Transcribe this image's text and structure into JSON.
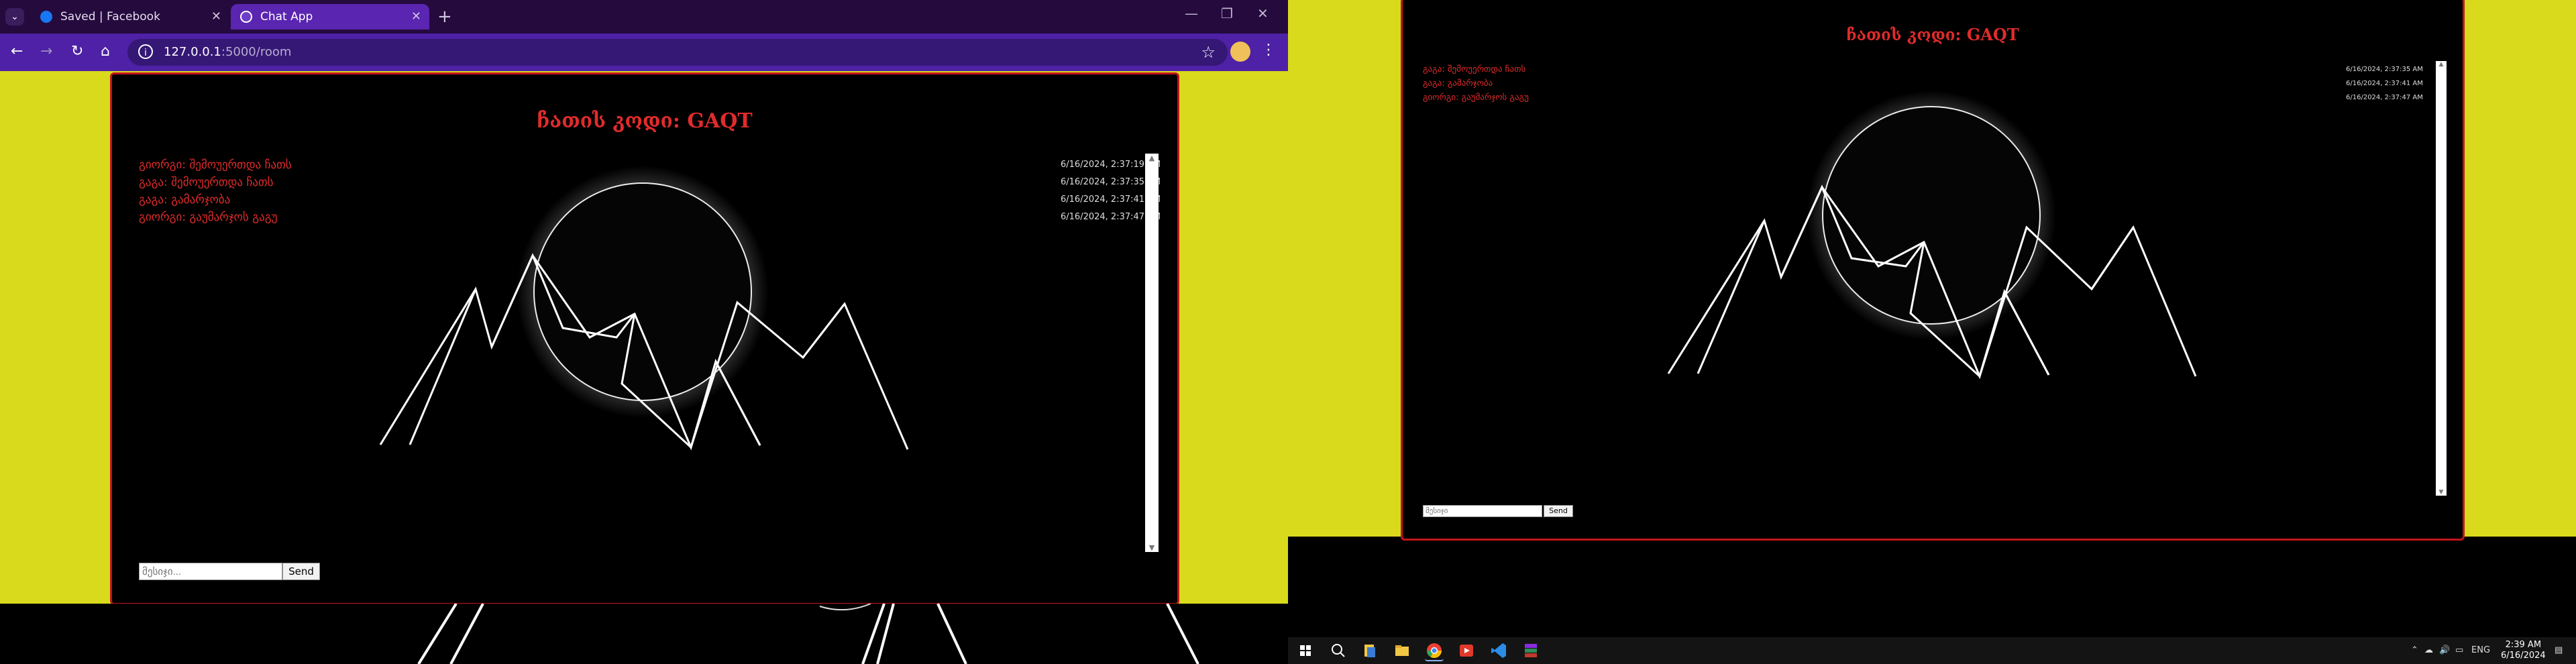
{
  "browser": {
    "tabs": [
      {
        "label": "Saved | Facebook",
        "active": false,
        "icon": "facebook-icon"
      },
      {
        "label": "Chat App",
        "active": true,
        "icon": "chat-app-icon"
      }
    ],
    "url_host": "127.0.0.1",
    "url_rest": ":5000/room"
  },
  "chat_left": {
    "title": "ჩათის კოდი: GAQT",
    "messages": [
      {
        "sender": "გიორგი",
        "text": "შემოუერთდა ჩათს",
        "time": "6/16/2024, 2:37:19 AM"
      },
      {
        "sender": "გაგა",
        "text": "შემოუერთდა ჩათს",
        "time": "6/16/2024, 2:37:35 AM"
      },
      {
        "sender": "გაგა",
        "text": "გამარჯობა",
        "time": "6/16/2024, 2:37:41 AM"
      },
      {
        "sender": "გიორგი",
        "text": "გაუმარჯოს გაგუ",
        "time": "6/16/2024, 2:37:47 AM"
      }
    ],
    "input_placeholder": "მესიჯი...",
    "send_label": "Send"
  },
  "chat_right": {
    "title": "ჩათის კოდი: GAQT",
    "messages": [
      {
        "sender": "გაგა",
        "text": "შემოუერთდა ჩათს",
        "time": "6/16/2024, 2:37:35 AM"
      },
      {
        "sender": "გაგა",
        "text": "გამარჯობა",
        "time": "6/16/2024, 2:37:41 AM"
      },
      {
        "sender": "გიორგი",
        "text": "გაუმარჯოს გაგუ",
        "time": "6/16/2024, 2:37:47 AM"
      }
    ],
    "input_placeholder": "მესიჯი",
    "send_label": "Send"
  },
  "taskbar": {
    "language": "ENG",
    "time": "2:39 AM",
    "date": "6/16/2024",
    "apps": [
      "start-icon",
      "search-icon",
      "file-explorer-icon",
      "folder-icon",
      "chrome-icon",
      "media-app-icon",
      "vscode-icon",
      "winrar-icon"
    ]
  },
  "colors": {
    "accent_red": "#e12b2b",
    "page_background": "#dada1c",
    "tab_strip": "#250a3e",
    "toolbar": "#4e21a6"
  }
}
